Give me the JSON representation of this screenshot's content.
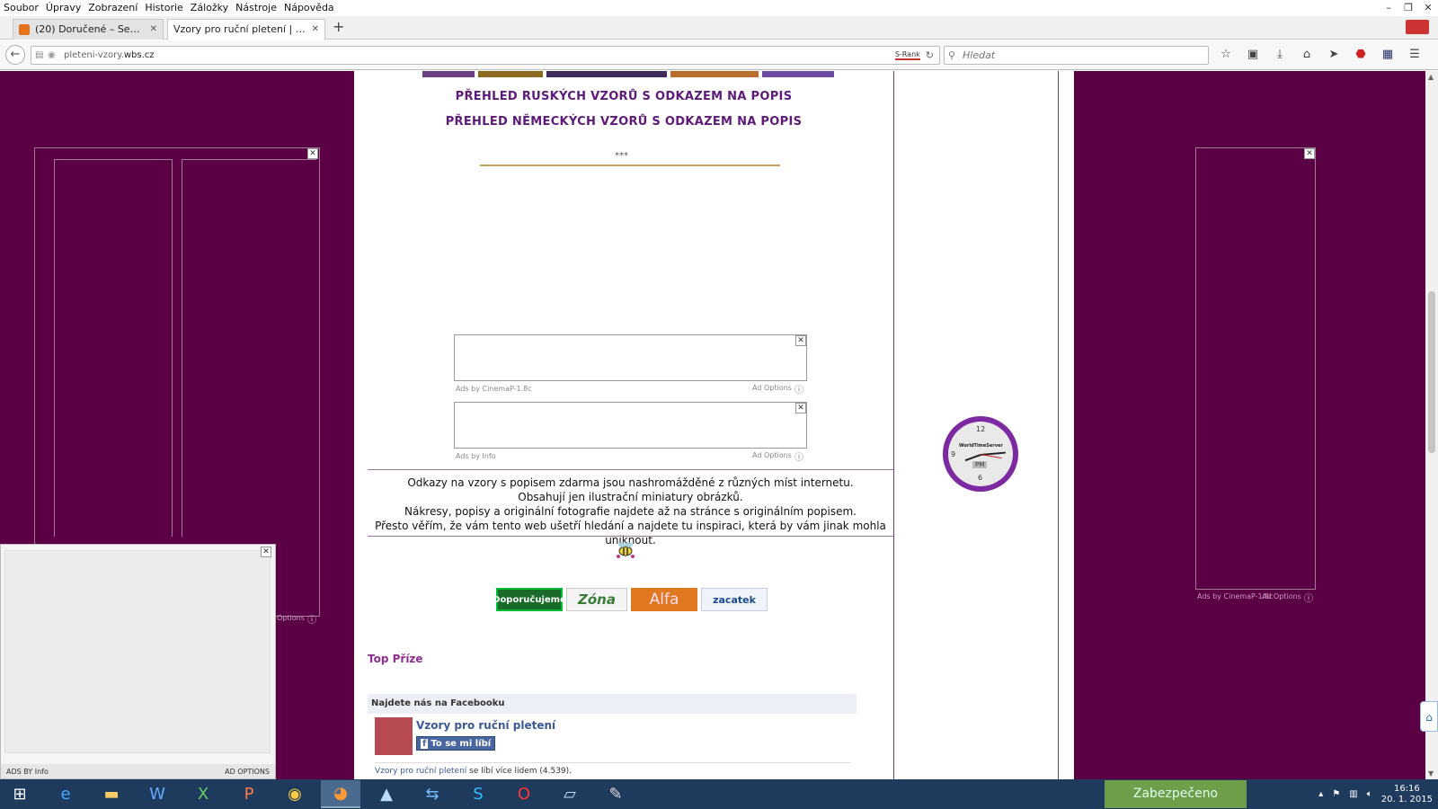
{
  "menu": [
    "Soubor",
    "Úpravy",
    "Zobrazení",
    "Historie",
    "Záložky",
    "Nástroje",
    "Nápověda"
  ],
  "tabs": [
    {
      "label": "(20) Doručené – Seznam E...",
      "active": false
    },
    {
      "label": "Vzory pro ruční pletení | Úvodn...",
      "active": true
    }
  ],
  "address": {
    "prefix": "pleteni-vzory.",
    "domain": "wbs.cz",
    "srank": "S-Rank"
  },
  "search": {
    "placeholder": "Hledat"
  },
  "content": {
    "link_russian": "PŘEHLED RUSKÝCH VZORŮ S ODKAZEM NA POPIS",
    "link_german": "PŘEHLED NĚMECKÝCH VZORŮ S ODKAZEM NA POPIS",
    "stars": "***",
    "ad1": {
      "left": "Ads by CinemaP-1.8c",
      "right": "Ad Options"
    },
    "ad2": {
      "left": "Ads by Info",
      "right": "Ad Options"
    },
    "notes": [
      "Odkazy na vzory s popisem zdarma jsou nashromážděné z různých míst internetu.",
      "Obsahují jen ilustrační miniatury obrázků.",
      "Nákresy, popisy a originální fotografie najdete až na stránce s originálním popisem.",
      "Přesto věřím, že vám tento web ušetří hledání a najdete tu inspiraci, která by vám jinak mohla uniknout."
    ],
    "badges": [
      "Doporučujeme",
      "Zóna",
      "Alfa",
      "zacatek"
    ],
    "top_prize": "Top Příze",
    "fb": {
      "heading": "Najdete nás na Facebooku",
      "page_name": "Vzory pro ruční pletení",
      "like": "To se mi líbí",
      "count_link": "Vzory pro ruční pletení",
      "count_text": " se líbí více lidem (4.539)."
    }
  },
  "left_ad": {
    "options": "Options"
  },
  "right_ad": {
    "left": "Ads by CinemaP-1.8c",
    "right": "Ad Options"
  },
  "bottom_ad": {
    "left": "ADS BY Info",
    "right": "AD OPTIONS"
  },
  "clock": {
    "brand": "WorldTimeServer",
    "n12": "12",
    "n6": "6",
    "n9": "9",
    "ampm": "PM"
  },
  "taskbar": {
    "secure": "Zabezpečeno",
    "time": "16:16",
    "date": "20. 1. 2015"
  },
  "colors": {
    "page_bg": "#5c0045",
    "heading": "#5d1a7a",
    "accent_purple": "#7d2aa2",
    "taskbar": "#1e3a5c",
    "secure": "#6d9e4a"
  }
}
